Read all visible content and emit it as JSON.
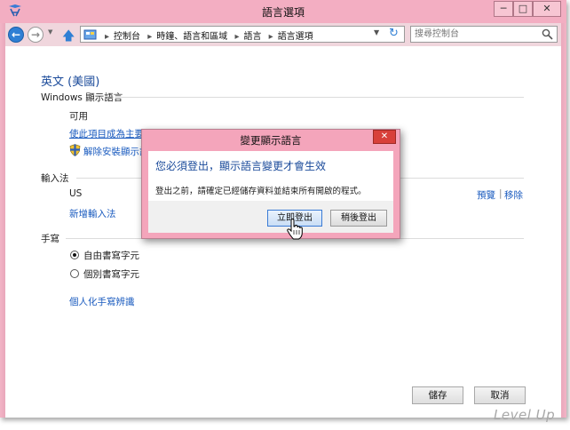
{
  "window": {
    "title": "語言選項",
    "caption_min": "─",
    "caption_max": "□",
    "caption_close": "✕"
  },
  "nav": {
    "breadcrumb": [
      "控制台",
      "時鐘、語言和區域",
      "語言",
      "語言選項"
    ],
    "search_placeholder": "搜尋控制台"
  },
  "content": {
    "language_heading": "英文 (美國)",
    "windows_display_language": {
      "label": "Windows 顯示語言",
      "status": "可用",
      "make_primary_link": "使此項目成為主要語言",
      "uninstall_link": "解除安裝顯示語言"
    },
    "input_method": {
      "label": "輸入法",
      "name": "US",
      "preview_link": "預覽",
      "separator": "|",
      "remove_link": "移除",
      "add_link": "新增輸入法"
    },
    "handwriting": {
      "label": "手寫",
      "options": [
        {
          "label": "自由書寫字元",
          "checked": true
        },
        {
          "label": "個別書寫字元",
          "checked": false
        }
      ],
      "personalize_link": "個人化手寫辨識"
    },
    "save_button": "儲存",
    "cancel_button": "取消"
  },
  "dialog": {
    "title": "變更顯示語言",
    "close": "✕",
    "message": "您必須登出，顯示語言變更才會生效",
    "detail": "登出之前，請確定已經儲存資料並結束所有開啟的程式。",
    "signout_now_button": "立即登出",
    "signout_later_button": "稍後登出"
  },
  "watermark": "Level Up",
  "colors": {
    "titlebar": "#f3aec2",
    "link": "#1a5bbf",
    "heading": "#1a4a9a",
    "dialog_frame": "#f4a5bb"
  }
}
